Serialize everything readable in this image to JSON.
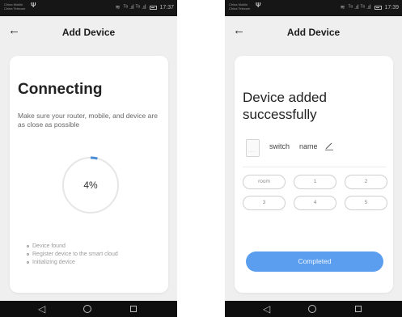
{
  "screens": [
    {
      "status_bar": {
        "carrier_line1": "China Mobile",
        "carrier_line2": "China Telecom",
        "signal": "ᵀᵒ .ıl ᵀᵒ .ıl",
        "time": "17:37"
      },
      "header": {
        "title": "Add Device",
        "back_icon": "arrow-left-icon"
      },
      "main": {
        "heading": "Connecting",
        "hint": "Make sure your router, mobile, and device are as close as possible",
        "progress": {
          "label": "4%",
          "value": 4
        },
        "steps": [
          "Device found",
          "Register device to the smart cloud",
          "Initializing device"
        ]
      },
      "nav_bar": {
        "back_glyph": "◁"
      }
    },
    {
      "status_bar": {
        "carrier_line1": "China Mobile",
        "carrier_line2": "China Telecom",
        "signal": "ᵀᵒ .ıl ᵀᵒ .ıl",
        "time": "17:39"
      },
      "header": {
        "title": "Add Device",
        "back_icon": "arrow-left-icon"
      },
      "main": {
        "heading": "Device added successfully",
        "device": {
          "type": "switch",
          "name": "name",
          "edit_icon": "pencil-icon"
        },
        "rooms": [
          "room",
          "1",
          "2",
          "3",
          "4",
          "5"
        ],
        "completed_label": "Completed"
      },
      "nav_bar": {
        "back_glyph": "◁"
      }
    }
  ],
  "colors": {
    "accent": "#5b9ef0",
    "progress_arc": "#4a8fd6",
    "ring_track": "#e6e6e6",
    "status_bar": "#161616",
    "nav_bar": "#0e0e0e",
    "background": "#efefef"
  },
  "icons": {
    "usb": "usb-icon",
    "wifi": "wifi-icon",
    "battery": "battery-icon",
    "home": "home-circle-icon",
    "recent": "recent-square-icon"
  }
}
